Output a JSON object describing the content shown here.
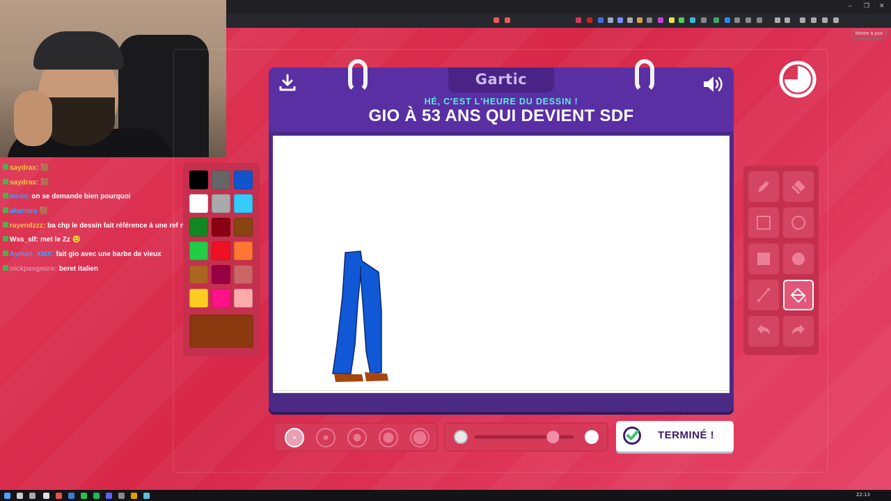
{
  "browser": {
    "update_label": "Mettre à jour"
  },
  "chat": {
    "lines": [
      {
        "user": "saydrax:",
        "message": "🟫",
        "user_color": "#f5c542"
      },
      {
        "user": "saydrax:",
        "message": "🟫",
        "user_color": "#f5c542"
      },
      {
        "user": "wsim:",
        "message": "on se demande bien pourquoi",
        "user_color": "#3aa0ff"
      },
      {
        "user": "akarrara",
        "message": "🟫",
        "user_color": "#3aa0ff"
      },
      {
        "user": "rayendzzz:",
        "message": "ba chp le dessin fait référence à une ref nn ?",
        "user_color": "#f5c542"
      },
      {
        "user": "Wss_slf:",
        "message": "met le Zz 😊",
        "user_color": "#ffffff"
      },
      {
        "user": "Ayman_XMX:",
        "message": "fait gio avec une barbe de vieux",
        "user_color": "#3aa0ff"
      },
      {
        "user": "nickpasgeure:",
        "message": "beret italien",
        "user_color": "#e58aa0"
      }
    ]
  },
  "palette": {
    "colors": [
      "#000000",
      "#666666",
      "#1155cc",
      "#ffffff",
      "#aaaaaa",
      "#33ccff",
      "#118822",
      "#880011",
      "#884411",
      "#22cc44",
      "#ee1122",
      "#ff7733",
      "#aa6622",
      "#990044",
      "#cc6666",
      "#ffcc22",
      "#ff1188",
      "#ffaaaa"
    ],
    "current_color": "#8b3a0f"
  },
  "game": {
    "logo": "Gartic",
    "subtitle": "HÉ, C'EST L'HEURE DU DESSIN !",
    "prompt": "GIO À 53 ANS QUI DEVIENT SDF",
    "done_label": "TERMINÉ !"
  },
  "tools": [
    {
      "name": "pencil",
      "icon": "pencil-icon"
    },
    {
      "name": "eraser",
      "icon": "eraser-icon"
    },
    {
      "name": "rectangle",
      "icon": "rectangle-outline-icon"
    },
    {
      "name": "ellipse",
      "icon": "ellipse-outline-icon"
    },
    {
      "name": "filled-rectangle",
      "icon": "rectangle-filled-icon"
    },
    {
      "name": "filled-ellipse",
      "icon": "ellipse-filled-icon"
    },
    {
      "name": "line",
      "icon": "line-icon"
    },
    {
      "name": "fill",
      "icon": "paint-bucket-icon",
      "active": true
    },
    {
      "name": "undo",
      "icon": "undo-icon"
    },
    {
      "name": "redo",
      "icon": "redo-icon"
    }
  ],
  "brush": {
    "sizes": 5,
    "selected_size_index": 0,
    "opacity": 0.8
  },
  "taskbar": {
    "clock": "22:13"
  }
}
